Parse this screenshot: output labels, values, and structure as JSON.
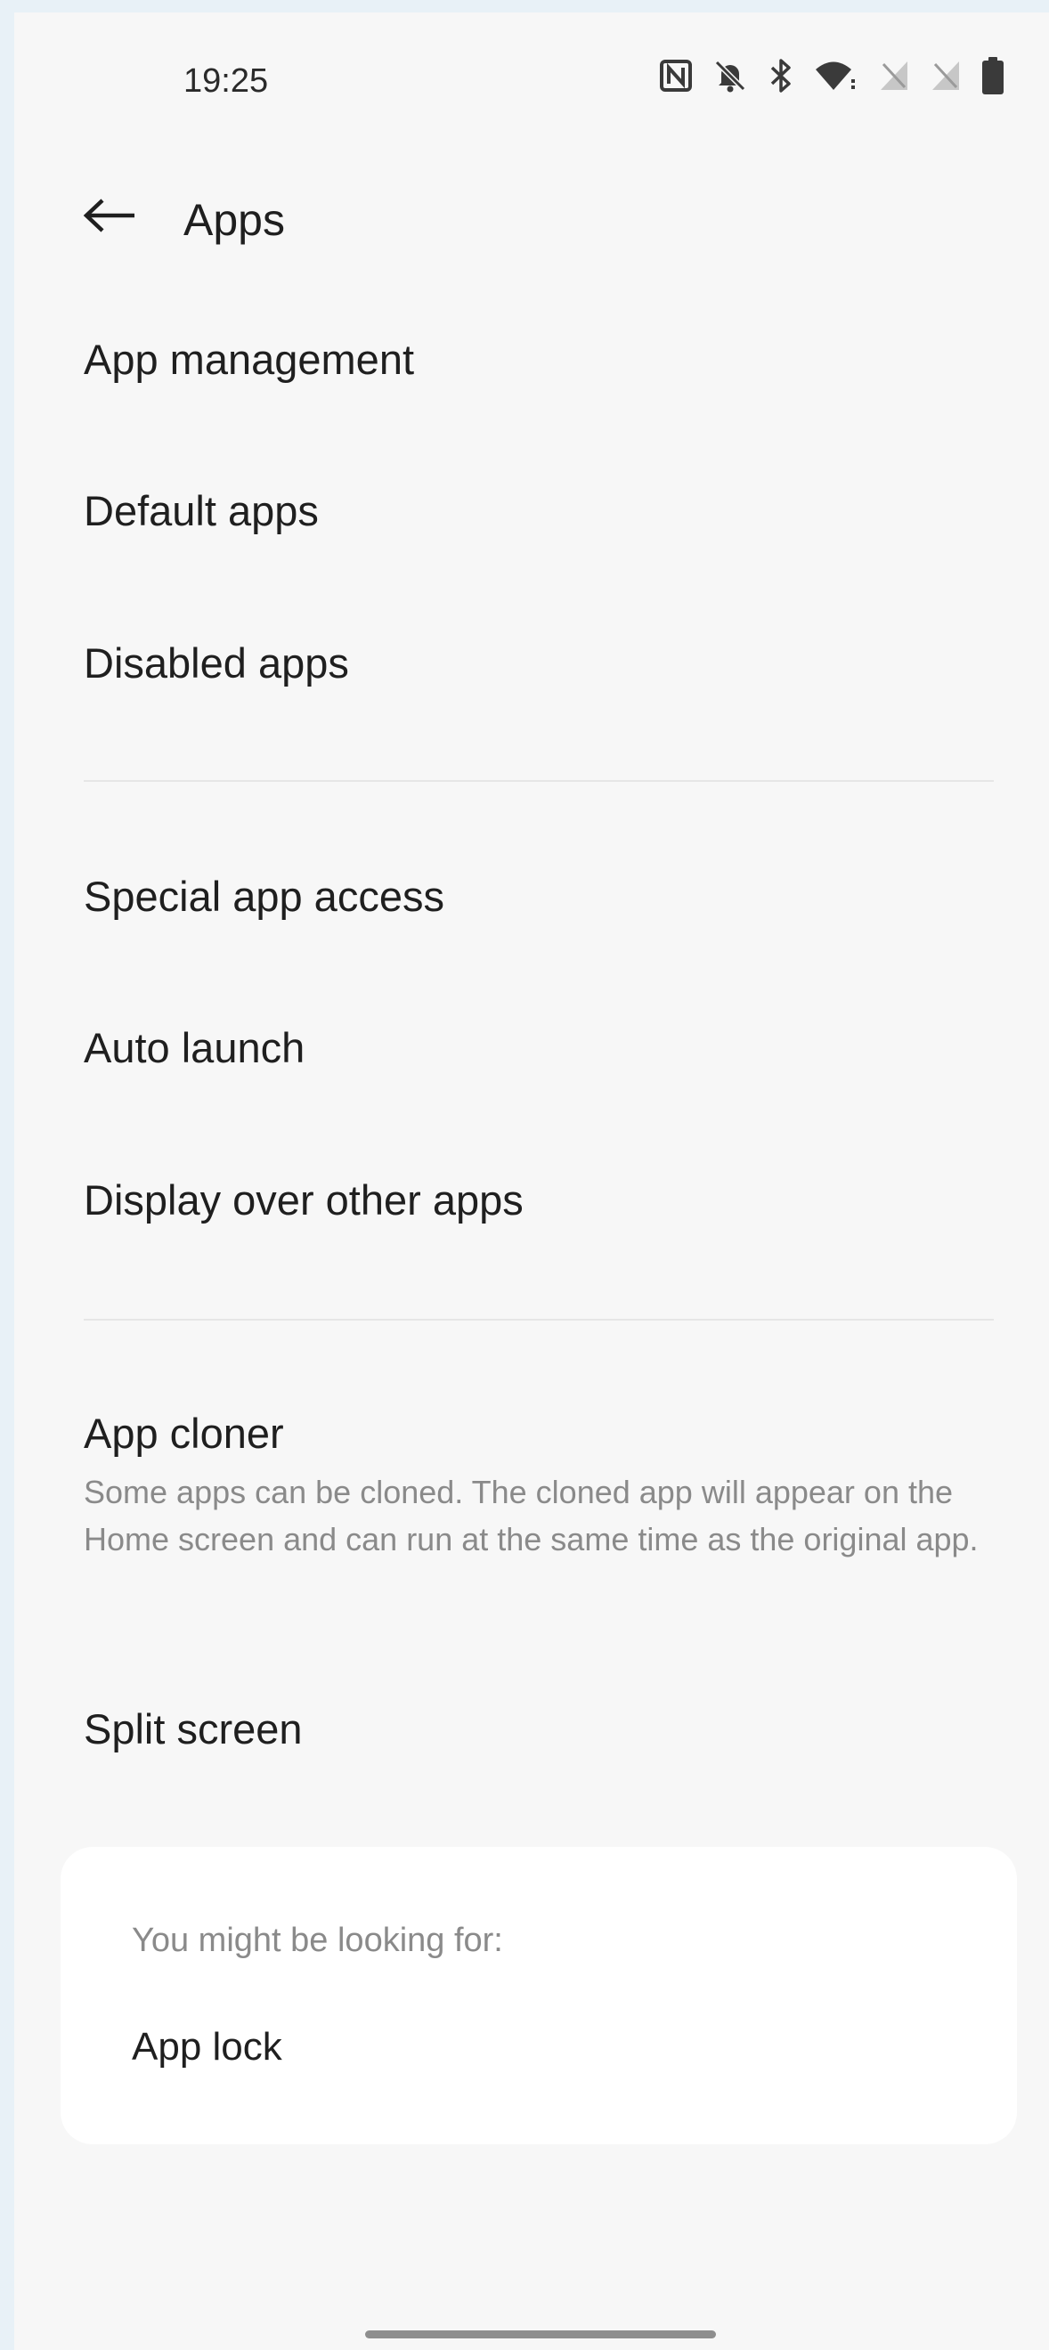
{
  "status_bar": {
    "time": "19:25",
    "icons": [
      "nfc-icon",
      "bell-off-icon",
      "bluetooth-icon",
      "wifi-icon",
      "no-sim-icon",
      "no-sim-icon",
      "battery-icon"
    ]
  },
  "header": {
    "back_icon": "arrow-left-icon",
    "title": "Apps"
  },
  "menu": {
    "app_management": "App management",
    "default_apps": "Default apps",
    "disabled_apps": "Disabled apps",
    "special_app_access": "Special app access",
    "auto_launch": "Auto launch",
    "display_over_other_apps": "Display over other apps",
    "app_cloner": "App cloner",
    "app_cloner_desc": "Some apps can be cloned. The cloned app will appear on the Home screen and can run at the same time as the original app.",
    "split_screen": "Split screen"
  },
  "suggestions": {
    "heading": "You might be looking for:",
    "items": [
      "App lock"
    ]
  },
  "colors": {
    "background": "#f7f7f7",
    "card": "#ffffff",
    "text_primary": "#1f1f1f",
    "text_secondary": "#8a8a8a",
    "divider": "#e6e6e6"
  }
}
